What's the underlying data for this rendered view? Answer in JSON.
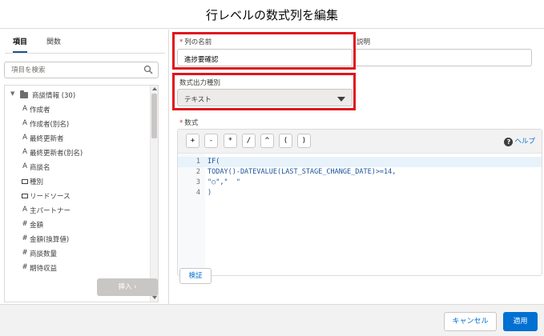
{
  "dialog": {
    "title": "行レベルの数式列を編集"
  },
  "left": {
    "tabs": [
      {
        "label": "項目"
      },
      {
        "label": "関数"
      }
    ],
    "search_placeholder": "項目を検索",
    "tree": {
      "root": {
        "label": "商談情報 (30)"
      },
      "items": [
        {
          "icon": "A",
          "label": "作成者"
        },
        {
          "icon": "A",
          "label": "作成者(別名)"
        },
        {
          "icon": "A",
          "label": "最終更新者"
        },
        {
          "icon": "A",
          "label": "最終更新者(別名)"
        },
        {
          "icon": "A",
          "label": "商談名"
        },
        {
          "icon": "select",
          "label": "種別"
        },
        {
          "icon": "select",
          "label": "リードソース"
        },
        {
          "icon": "A",
          "label": "主パートナー"
        },
        {
          "icon": "#",
          "label": "金額"
        },
        {
          "icon": "#",
          "label": "金額(換算値)"
        },
        {
          "icon": "#",
          "label": "商談数量"
        },
        {
          "icon": "#",
          "label": "期待収益"
        }
      ]
    },
    "insert_label": "挿入 ›"
  },
  "right": {
    "column_name": {
      "label": "列の名前",
      "value": "進捗要確認"
    },
    "description": {
      "label": "説明"
    },
    "output_type": {
      "label": "数式出力種別",
      "value": "テキスト"
    },
    "formula": {
      "label": "数式",
      "operators": [
        "+",
        "-",
        "*",
        "/",
        "^",
        "(",
        ")"
      ],
      "help_label": "ヘルプ",
      "lines": [
        {
          "num": "1",
          "text": "IF("
        },
        {
          "num": "2",
          "text": "TODAY()-DATEVALUE(LAST_STAGE_CHANGE_DATE)>=14,"
        },
        {
          "num": "3",
          "text": "\"○\",\"  \""
        },
        {
          "num": "4",
          "text": ")"
        }
      ]
    },
    "validate_label": "検証"
  },
  "footer": {
    "cancel_label": "キャンセル",
    "apply_label": "適用"
  },
  "colors": {
    "accent": "#0070d2",
    "highlight_box": "#e0141e",
    "brand_tab": "#1b5297"
  }
}
